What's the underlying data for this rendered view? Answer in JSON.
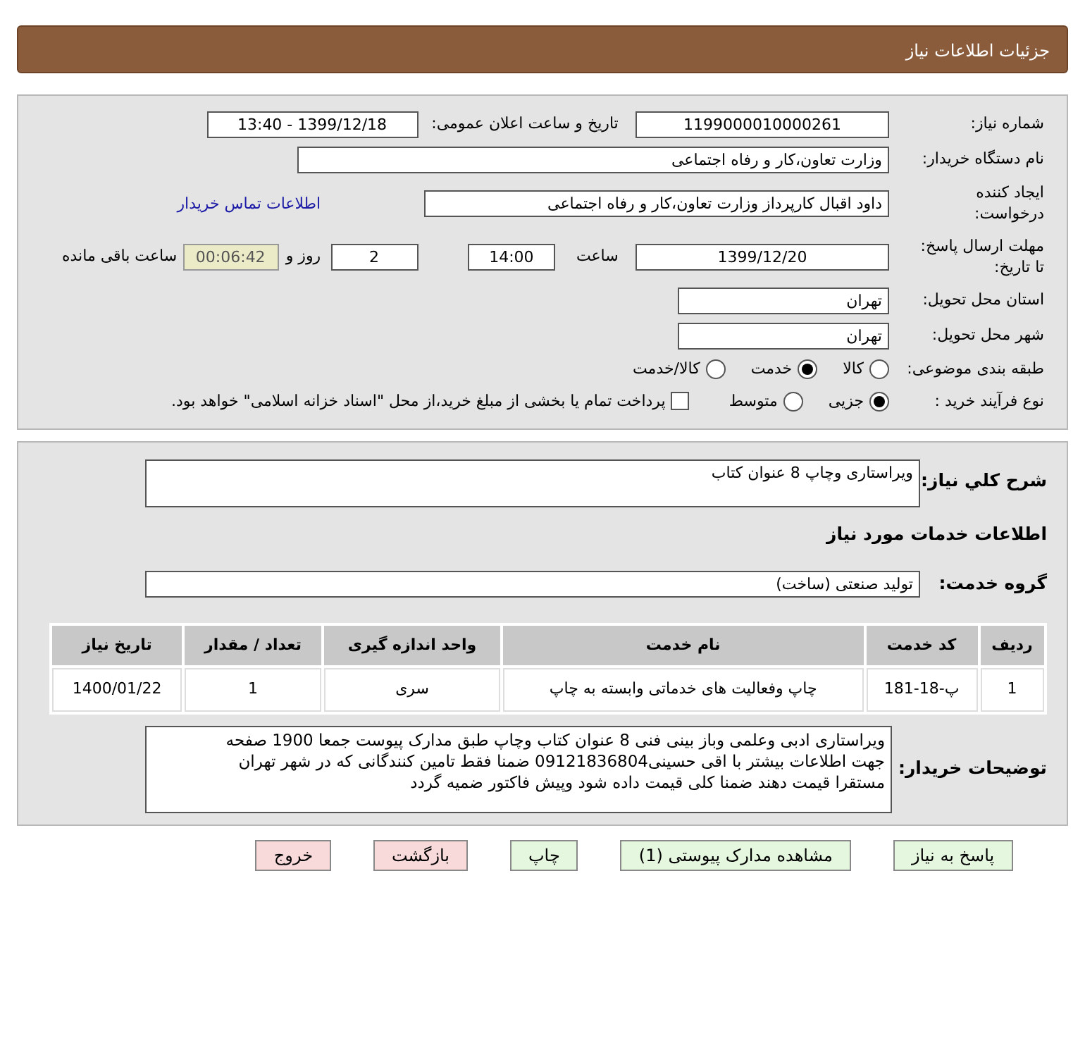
{
  "header": {
    "title": "جزئیات اطلاعات نیاز"
  },
  "need_number": {
    "label": "شماره نیاز:",
    "value": "1199000010000261"
  },
  "announce": {
    "label": "تاریخ و ساعت اعلان عمومی:",
    "value": "1399/12/18 - 13:40"
  },
  "buyer_org": {
    "label": "نام دستگاه خریدار:",
    "value": "وزارت تعاون،کار و رفاه اجتماعی"
  },
  "creator": {
    "label": "ایجاد کننده درخواست:",
    "value": "داود اقبال کارپرداز وزارت تعاون،کار و رفاه اجتماعی",
    "link": "اطلاعات تماس خریدار"
  },
  "deadline": {
    "label": "مهلت ارسال پاسخ: تا تاریخ:",
    "date": "1399/12/20",
    "time_label": "ساعت",
    "time": "14:00",
    "days": "2",
    "days_label": "روز و",
    "remaining": "00:06:42",
    "remaining_label": "ساعت باقی مانده"
  },
  "province": {
    "label": "استان محل تحویل:",
    "value": "تهران"
  },
  "city": {
    "label": "شهر محل تحویل:",
    "value": "تهران"
  },
  "category": {
    "label": "طبقه بندی موضوعی:",
    "options": [
      {
        "label": "کالا",
        "selected": false
      },
      {
        "label": "خدمت",
        "selected": true
      },
      {
        "label": "کالا/خدمت",
        "selected": false
      }
    ]
  },
  "process": {
    "label": "نوع فرآیند خرید :",
    "options": [
      {
        "label": "جزیی",
        "selected": true
      },
      {
        "label": "متوسط",
        "selected": false
      }
    ],
    "payment_checkbox": {
      "checked": false,
      "label": "پرداخت تمام یا بخشی از مبلغ خرید،از محل \"اسناد خزانه اسلامی\" خواهد بود."
    }
  },
  "summary": {
    "label": "شرح کلي نياز:",
    "value": "ویراستاری وچاپ 8 عنوان کتاب"
  },
  "services_heading": "اطلاعات خدمات مورد نیاز",
  "service_group": {
    "label": "گروه خدمت:",
    "value": "تولید صنعتی (ساخت)"
  },
  "table": {
    "columns": [
      "ردیف",
      "کد خدمت",
      "نام خدمت",
      "واحد اندازه گیری",
      "تعداد / مقدار",
      "تاریخ نیاز"
    ],
    "rows": [
      [
        "1",
        "پ-18-181",
        "چاپ وفعالیت های خدماتی وابسته به چاپ",
        "سری",
        "1",
        "1400/01/22"
      ]
    ]
  },
  "buyer_notes": {
    "label": "توضیحات خریدار:",
    "lines": [
      "ویراستاری ادبی وعلمی وباز بینی فنی 8 عنوان کتاب وچاپ طبق مدارک پیوست جمعا 1900 صفحه",
      "جهت اطلاعات بیشتر با اقی حسینی09121836804 ضمنا فقط تامین کنندگانی که در شهر تهران",
      "مستقرا قیمت دهند ضمنا کلی قیمت داده شود وپیش فاکتور ضمیه گردد"
    ]
  },
  "buttons": [
    {
      "label": "پاسخ به نیاز",
      "kind": "green"
    },
    {
      "label": "مشاهده مدارک پیوستی (1)",
      "kind": "green"
    },
    {
      "label": "چاپ",
      "kind": "green"
    },
    {
      "label": "بازگشت",
      "kind": "red"
    },
    {
      "label": "خروج",
      "kind": "red"
    }
  ]
}
